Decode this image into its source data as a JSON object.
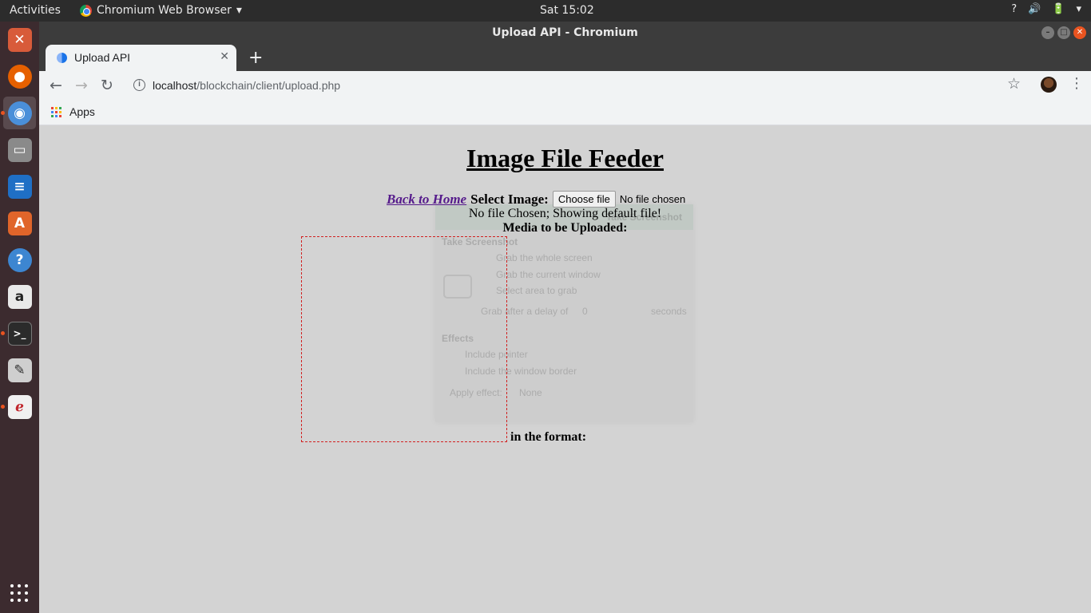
{
  "system_bar": {
    "activities": "Activities",
    "app_name": "Chromium Web Browser",
    "clock": "Sat 15:02",
    "tray": [
      "?",
      "🔊",
      "🔋",
      "▾"
    ]
  },
  "launcher": {
    "apps": [
      {
        "name": "system-settings",
        "glyph": "✕",
        "color": "#d85b3a"
      },
      {
        "name": "firefox",
        "glyph": "●",
        "color": "#e66000"
      },
      {
        "name": "chromium",
        "glyph": "◉",
        "color": "#4a8fd9"
      },
      {
        "name": "files",
        "glyph": "▭",
        "color": "#8a8a8a"
      },
      {
        "name": "libreoffice-writer",
        "glyph": "≡",
        "color": "#1f6fc5"
      },
      {
        "name": "ubuntu-software",
        "glyph": "A",
        "color": "#e0652a"
      },
      {
        "name": "help",
        "glyph": "?",
        "color": "#3d86d1"
      },
      {
        "name": "amazon",
        "glyph": "a",
        "color": "#e9e9e9"
      },
      {
        "name": "terminal",
        "glyph": ">_",
        "color": "#2b2b2b"
      },
      {
        "name": "text-editor",
        "glyph": "✎",
        "color": "#cfcfcf"
      },
      {
        "name": "document-viewer",
        "glyph": "ℯ",
        "color": "#f0f0f0"
      }
    ]
  },
  "window": {
    "title": "Upload API - Chromium"
  },
  "browser": {
    "tab_title": "Upload API",
    "url_host": "localhost",
    "url_path": "/blockchain/client/upload.php",
    "bookmarks_apps": "Apps"
  },
  "page": {
    "title": "Image File Feeder",
    "back_link": "Back to Home",
    "select_label": "Select Image:",
    "choose_button": "Choose file",
    "no_file": "No file chosen",
    "message": "No file Chosen; Showing default file!",
    "media_label": "Media to be Uploaded:",
    "format_label": "in the format:"
  },
  "ghost_dialog": {
    "header": "Take Screenshot",
    "section_take": "Take Screenshot",
    "opt_whole": "Grab the whole screen",
    "opt_window": "Grab the current window",
    "opt_area": "Select area to grab",
    "delay_label": "Grab after a delay of",
    "delay_value": "0",
    "delay_unit": "seconds",
    "section_effects": "Effects",
    "opt_pointer": "Include pointer",
    "opt_border": "Include the window border",
    "apply_label": "Apply effect:",
    "apply_value": "None"
  },
  "colors": {
    "page_background": "#d3d3d3",
    "link_visited": "#551a8b",
    "image_border": "#d12020",
    "ubuntu_orange": "#e95420"
  }
}
